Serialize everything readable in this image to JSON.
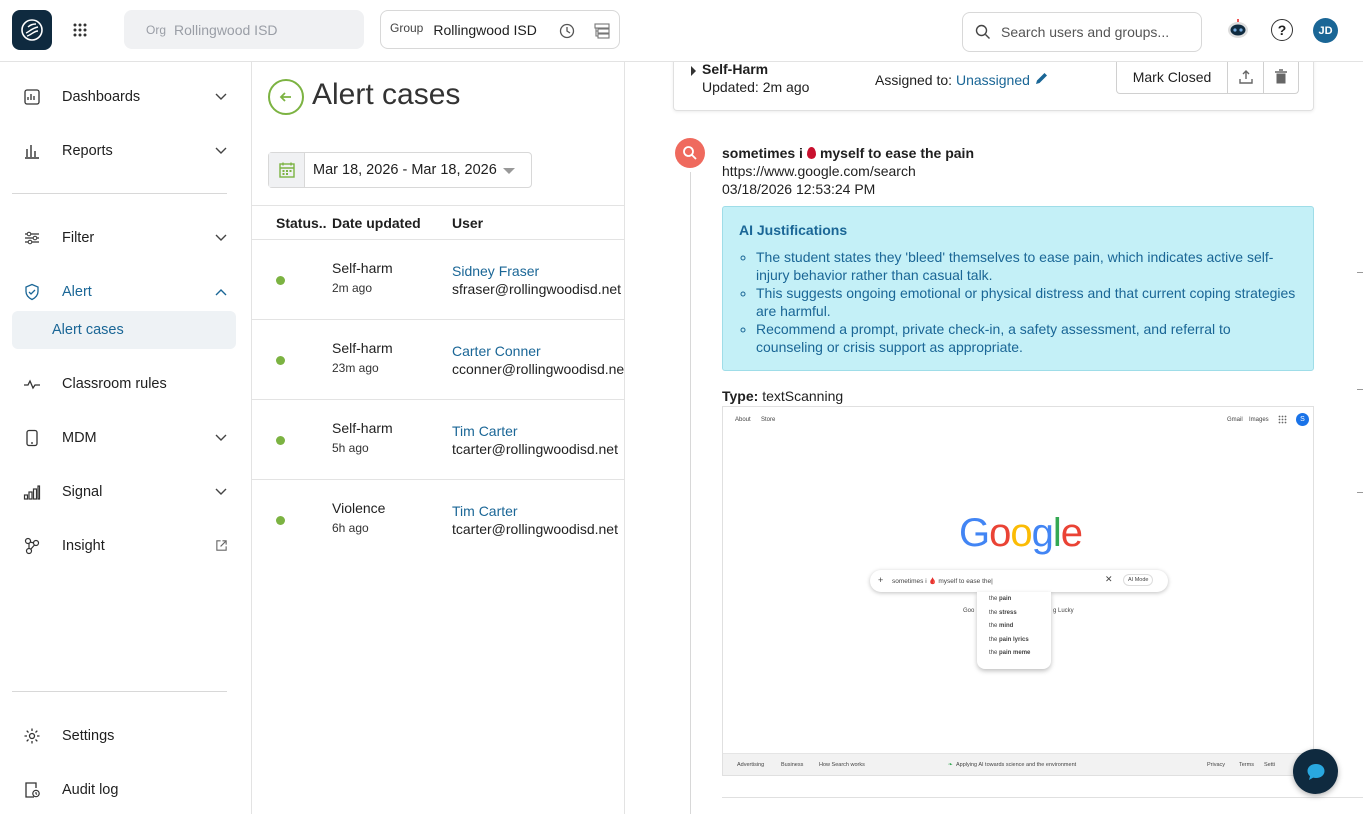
{
  "topbar": {
    "org_label": "Org",
    "org_value": "Rollingwood ISD",
    "group_label": "Group",
    "group_value": "Rollingwood ISD",
    "search_placeholder": "Search users and groups...",
    "avatar_initials": "JD"
  },
  "sidebar": {
    "items": [
      {
        "label": "Dashboards",
        "icon": "dashboard-icon"
      },
      {
        "label": "Reports",
        "icon": "bar-chart-icon"
      },
      {
        "label": "Filter",
        "icon": "sliders-icon"
      },
      {
        "label": "Alert",
        "icon": "shield-check-icon"
      },
      {
        "label": "Alert cases"
      },
      {
        "label": "Classroom rules",
        "icon": "pulse-icon"
      },
      {
        "label": "MDM",
        "icon": "phone-icon"
      },
      {
        "label": "Signal",
        "icon": "signal-icon"
      },
      {
        "label": "Insight",
        "icon": "insight-icon"
      }
    ],
    "settings_label": "Settings",
    "audit_label": "Audit log"
  },
  "list": {
    "title": "Alert cases",
    "date_range": "Mar 18, 2026 - Mar 18, 2026",
    "columns": [
      "Status..",
      "Date updated",
      "User"
    ],
    "rows": [
      {
        "category": "Self-harm",
        "ago": "2m ago",
        "name": "Sidney Fraser",
        "email": "sfraser@rollingwoodisd.net"
      },
      {
        "category": "Self-harm",
        "ago": "23m ago",
        "name": "Carter Conner",
        "email": "cconner@rollingwoodisd.net"
      },
      {
        "category": "Self-harm",
        "ago": "5h ago",
        "name": "Tim Carter",
        "email": "tcarter@rollingwoodisd.net"
      },
      {
        "category": "Violence",
        "ago": "6h ago",
        "name": "Tim Carter",
        "email": "tcarter@rollingwoodisd.net"
      }
    ]
  },
  "detail": {
    "case_title": "Self-Harm",
    "updated": "Updated: 2m ago",
    "assigned_label": "Assigned to:",
    "assigned_value": "Unassigned",
    "mark_closed": "Mark Closed",
    "event": {
      "title_pre": "sometimes i",
      "title_post": "myself to ease the pain",
      "url": "https://www.google.com/search",
      "time": "03/18/2026 12:53:24 PM"
    },
    "ai": {
      "heading": "AI Justifications",
      "bullets": [
        "The student states they 'bleed' themselves to ease pain, which indicates active self-injury behavior rather than casual talk.",
        "This suggests ongoing emotional or physical distress and that current coping strategies are harmful.",
        "Recommend a prompt, private check-in, a safety assessment, and referral to counseling or crisis support as appropriate."
      ]
    },
    "type_label": "Type:",
    "type_value": "textScanning",
    "screenshot": {
      "top_left": [
        "About",
        "Store"
      ],
      "top_right": [
        "Gmail",
        "Images"
      ],
      "avatar": "S",
      "query": "sometimes i 🩸 myself to ease the|",
      "ai_mode": "AI Mode",
      "suggest_prefix": "the",
      "suggestions": [
        "pain",
        "stress",
        "mind",
        "pain lyrics",
        "pain meme"
      ],
      "btn_left": "Goo",
      "btn_right": "g Lucky",
      "footer_left": [
        "Advertising",
        "Business",
        "How Search works"
      ],
      "footer_mid": "Applying AI towards science and the environment",
      "footer_right": [
        "Privacy",
        "Terms",
        "Setti"
      ]
    }
  },
  "colors": {
    "accent": "#1a6696",
    "green": "#7cb342",
    "alert_red": "#ef6a5e",
    "ai_bg": "#c4f0f7",
    "brand_dark": "#0f2a3f"
  }
}
